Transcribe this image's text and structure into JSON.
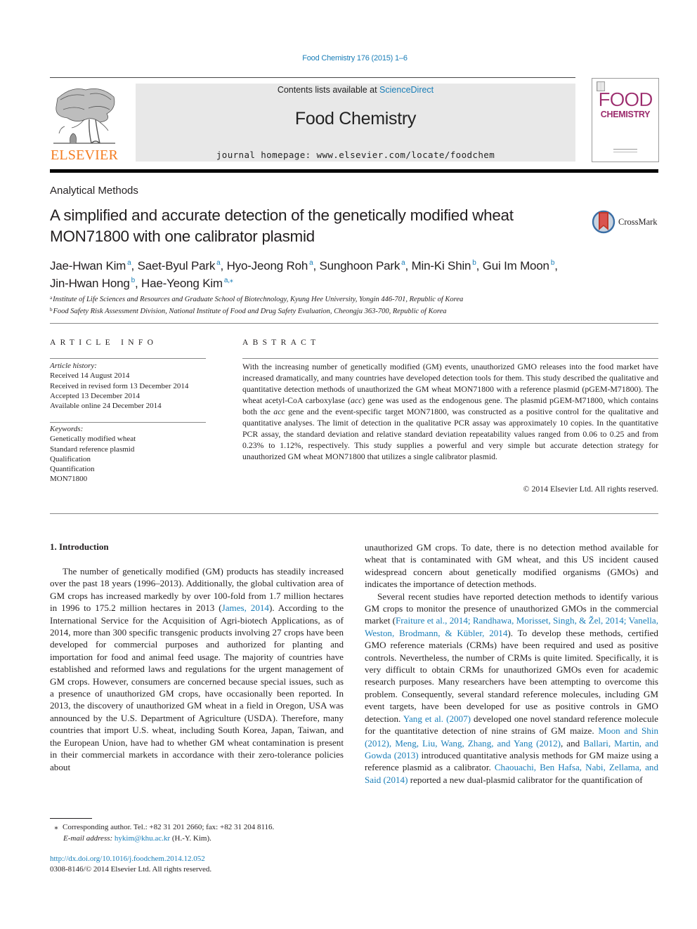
{
  "header": {
    "citation": "Food Chemistry 176 (2015) 1–6",
    "publisher_wordmark": "ELSEVIER",
    "contents_prefix": "Contents lists available at ",
    "contents_link": "ScienceDirect",
    "journal_name": "Food Chemistry",
    "homepage_prefix": "journal homepage: ",
    "homepage_url": "www.elsevier.com/locate/foodchem",
    "cover_line1": "FOOD",
    "cover_line2": "CHEMISTRY"
  },
  "colors": {
    "link": "#1a7eb8",
    "elsevier_orange": "#f47c20",
    "cover_magenta": "#9b2a6c",
    "masthead_gray": "#e8e8e8"
  },
  "article": {
    "section": "Analytical Methods",
    "title": "A simplified and accurate detection of the genetically modified wheat MON71800 with one calibrator plasmid",
    "crossmark_label": "CrossMark",
    "authors": [
      {
        "name": "Jae-Hwan Kim",
        "aff": "a",
        "sep": ", "
      },
      {
        "name": "Saet-Byul Park",
        "aff": "a",
        "sep": ", "
      },
      {
        "name": "Hyo-Jeong Roh",
        "aff": "a",
        "sep": ", "
      },
      {
        "name": "Sunghoon Park",
        "aff": "a",
        "sep": ", "
      },
      {
        "name": "Min-Ki Shin",
        "aff": "b",
        "sep": ", "
      },
      {
        "name": "Gui Im Moon",
        "aff": "b",
        "sep": ","
      },
      {
        "name": "Jin-Hwan Hong",
        "aff": "b",
        "sep": ", "
      },
      {
        "name": "Hae-Yeong Kim",
        "aff": "a,⁎",
        "sep": ""
      }
    ],
    "affiliations": [
      {
        "key": "a",
        "text": "Institute of Life Sciences and Resources and Graduate School of Biotechnology, Kyung Hee University, Yongin 446-701, Republic of Korea"
      },
      {
        "key": "b",
        "text": "Food Safety Risk Assessment Division, National Institute of Food and Drug Safety Evaluation, Cheongju 363-700, Republic of Korea"
      }
    ]
  },
  "article_info": {
    "heading": "ARTICLE INFO",
    "history_label": "Article history:",
    "history": [
      "Received 14 August 2014",
      "Received in revised form 13 December 2014",
      "Accepted 13 December 2014",
      "Available online 24 December 2014"
    ],
    "keywords_label": "Keywords:",
    "keywords": [
      "Genetically modified wheat",
      "Standard reference plasmid",
      "Qualification",
      "Quantification",
      "MON71800"
    ]
  },
  "abstract": {
    "heading": "ABSTRACT",
    "p1": "With the increasing number of genetically modified (GM) events, unauthorized GMO releases into the food market have increased dramatically, and many countries have developed detection tools for them. This study described the qualitative and quantitative detection methods of unauthorized the GM wheat MON71800 with a reference plasmid (pGEM-M71800). The wheat acetyl-CoA carboxylase (",
    "italic1": "acc",
    "p2": ") gene was used as the endogenous gene. The plasmid pGEM-M71800, which contains both the ",
    "italic2": "acc",
    "p3": " gene and the event-specific target MON71800, was constructed as a positive control for the qualitative and quantitative analyses. The limit of detection in the qualitative PCR assay was approximately 10 copies. In the quantitative PCR assay, the standard deviation and relative standard deviation repeatability values ranged from 0.06 to 0.25 and from 0.23% to 1.12%, respectively. This study supplies a powerful and very simple but accurate detection strategy for unauthorized GM wheat MON71800 that utilizes a single calibrator plasmid.",
    "copyright": "© 2014 Elsevier Ltd. All rights reserved."
  },
  "body": {
    "intro_heading": "1. Introduction",
    "left": {
      "p1_a": "The number of genetically modified (GM) products has steadily increased over the past 18 years (1996–2013). Additionally, the global cultivation area of GM crops has increased markedly by over 100-fold from 1.7 million hectares in 1996 to 175.2 million hectares in 2013 (",
      "p1_link": "James, 2014",
      "p1_b": "). According to the International Service for the Acquisition of Agri-biotech Applications, as of 2014, more than 300 specific transgenic products involving 27 crops have been developed for commercial purposes and authorized for planting and importation for food and animal feed usage. The majority of countries have established and reformed laws and regulations for the urgent management of GM crops. However, consumers are concerned because special issues, such as a presence of unauthorized GM crops, have occasionally been reported. In 2013, the discovery of unauthorized GM wheat in a field in Oregon, USA was announced by the U.S. Department of Agriculture (USDA). Therefore, many countries that import U.S. wheat, including South Korea, Japan, Taiwan, and the European Union, have had to whether GM wheat contamination is present in their commercial markets in accordance with their zero-tolerance policies about"
    },
    "right": {
      "p1": "unauthorized GM crops. To date, there is no detection method available for wheat that is contaminated with GM wheat, and this US incident caused widespread concern about genetically modified organisms (GMOs) and indicates the importance of detection methods.",
      "p2_a": "Several recent studies have reported detection methods to identify various GM crops to monitor the presence of unauthorized GMOs in the commercial market (",
      "p2_link1": "Fraiture et al., 2014; Randhawa, Morisset, Singh, & Žel, 2014; Vanella, Weston, Brodmann, & Kübler, 2014",
      "p2_b": "). To develop these methods, certified GMO reference materials (CRMs) have been required and used as positive controls. Nevertheless, the number of CRMs is quite limited. Specifically, it is very difficult to obtain CRMs for unauthorized GMOs even for academic research purposes. Many researchers have been attempting to overcome this problem. Consequently, several standard reference molecules, including GM event targets, have been developed for use as positive controls in GMO detection. ",
      "p2_link2": "Yang et al. (2007)",
      "p2_c": " developed one novel standard reference molecule for the quantitative detection of nine strains of GM maize. ",
      "p2_link3": "Moon and Shin (2012), Meng, Liu, Wang, Zhang, and Yang (2012)",
      "p2_d": ", and ",
      "p2_link4": "Ballari, Martin, and Gowda (2013)",
      "p2_e": " introduced quantitative analysis methods for GM maize using a reference plasmid as a calibrator. ",
      "p2_link5": "Chaouachi, Ben Hafsa, Nabi, Zellama, and Said (2014)",
      "p2_f": " reported a new dual-plasmid calibrator for the quantification of"
    }
  },
  "footnote": {
    "star": "⁎",
    "corresponding": "Corresponding author. Tel.: +82 31 201 2660; fax: +82 31 204 8116.",
    "email_label": "E-mail address: ",
    "email": "hykim@khu.ac.kr",
    "email_suffix": " (H.-Y. Kim)."
  },
  "doi": {
    "url": "http://dx.doi.org/10.1016/j.foodchem.2014.12.052",
    "issn_copyright": "0308-8146/© 2014 Elsevier Ltd. All rights reserved."
  }
}
